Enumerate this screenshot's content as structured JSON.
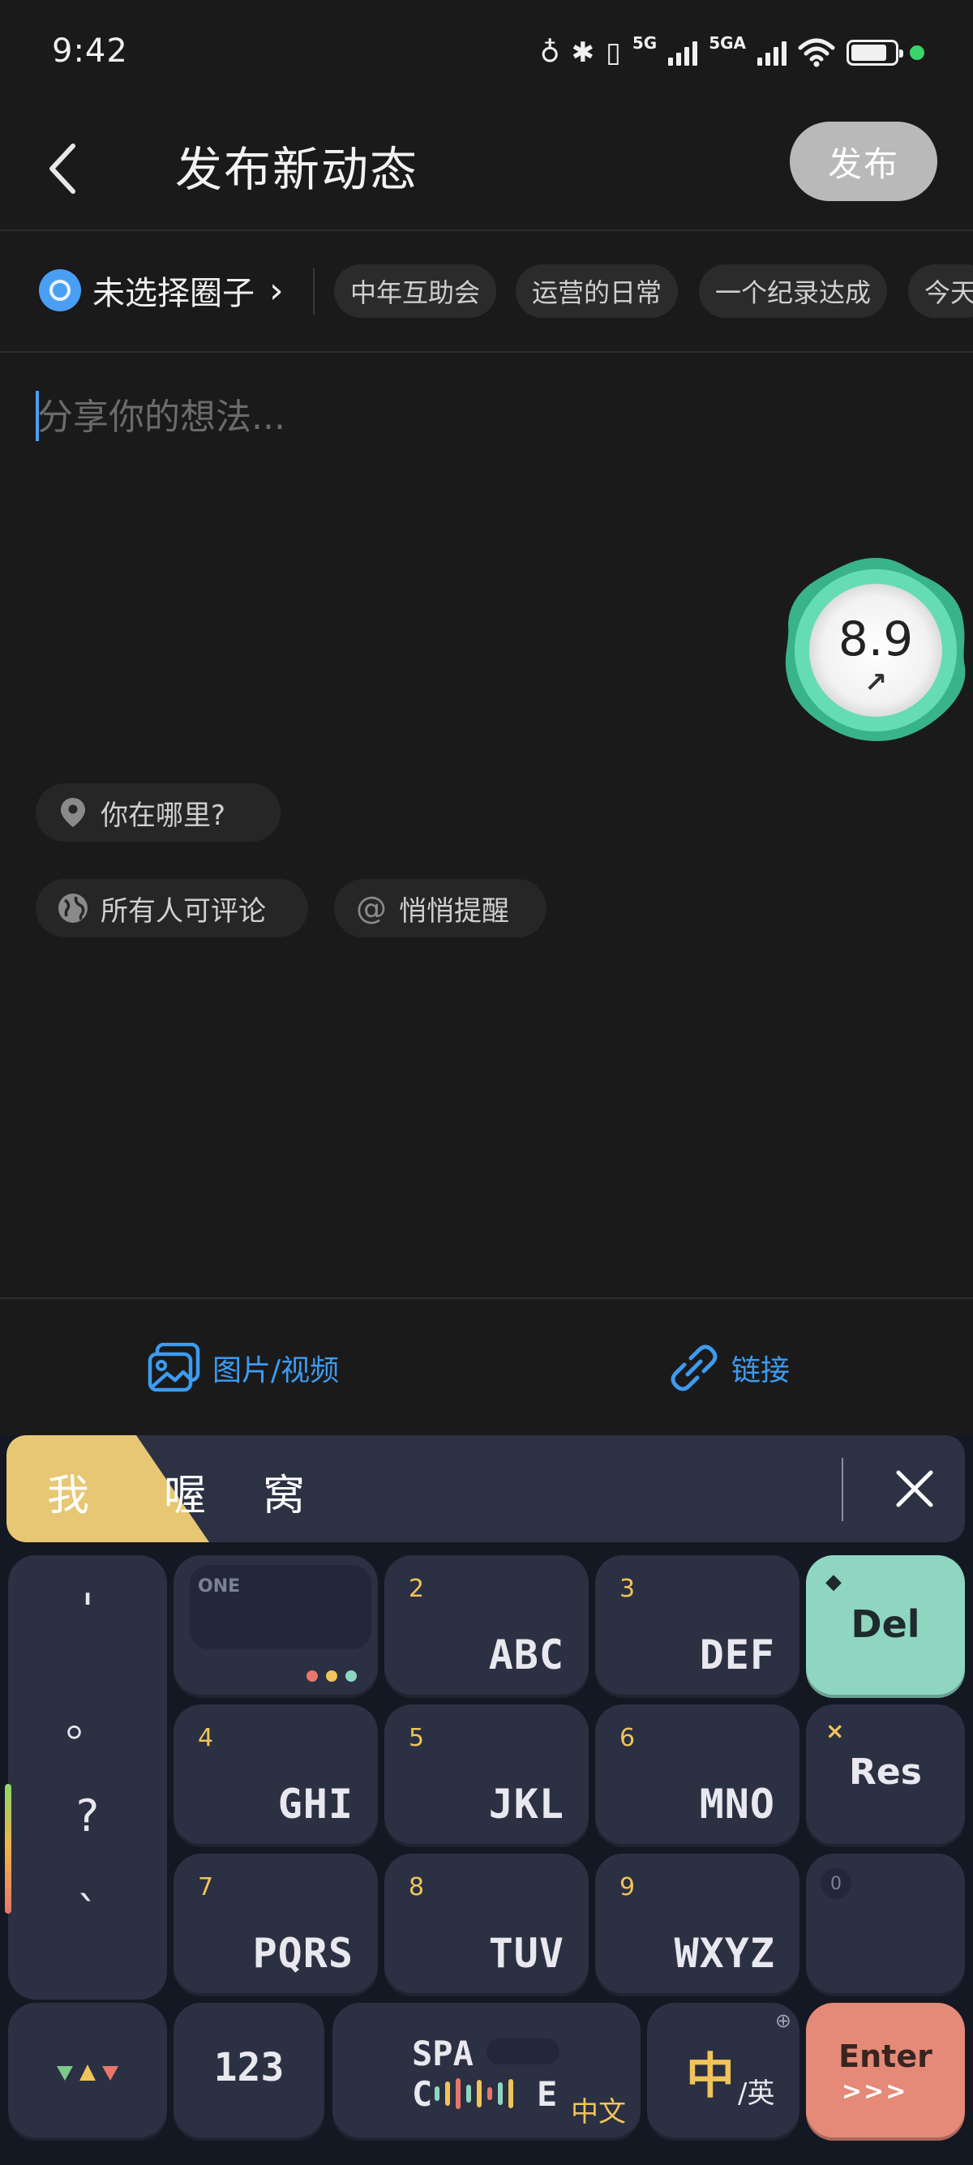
{
  "status_bar": {
    "time": "9:42",
    "network_1": "5G",
    "network_2": "5GA"
  },
  "header": {
    "back_icon": "chevron-left-icon",
    "title": "发布新动态",
    "publish_label": "发布"
  },
  "circle_row": {
    "select_label": "未选择圈子",
    "chips": [
      "中年互助会",
      "运营的日常",
      "一个纪录达成",
      "今天"
    ]
  },
  "composer": {
    "placeholder": "分享你的想法..."
  },
  "score_widget": {
    "value": "8.9",
    "arrow": "↗"
  },
  "options": {
    "location_label": "你在哪里?",
    "comment_label": "所有人可评论",
    "mention_label": "悄悄提醒"
  },
  "attach_bar": {
    "media_label": "图片/视频",
    "link_label": "链接"
  },
  "keyboard": {
    "candidates": [
      "我",
      "喔",
      "窝"
    ],
    "punctuation": [
      "'",
      "。",
      "?",
      "`"
    ],
    "one_label": "ONE",
    "keys": [
      {
        "num": "2",
        "letters": "ABC"
      },
      {
        "num": "3",
        "letters": "DEF"
      },
      {
        "num": "4",
        "letters": "GHI"
      },
      {
        "num": "5",
        "letters": "JKL"
      },
      {
        "num": "6",
        "letters": "MNO"
      },
      {
        "num": "7",
        "letters": "PQRS"
      },
      {
        "num": "8",
        "letters": "TUV"
      },
      {
        "num": "9",
        "letters": "WXYZ"
      }
    ],
    "del_label": "Del",
    "res_label": "Res",
    "zero_label": "0",
    "num_switch_label": "123",
    "space_top": "SPA",
    "space_bottom_left": "C",
    "space_bottom_right": "E",
    "space_lang": "中文",
    "lang_main": "中",
    "lang_sub": "/英",
    "enter_label": "Enter",
    "enter_chevrons": ">>>",
    "colors": {
      "accent_yellow": "#f0c45a",
      "del_green": "#8fd6c0",
      "enter_red": "#e58a78",
      "key_bg": "#2b3042"
    }
  }
}
